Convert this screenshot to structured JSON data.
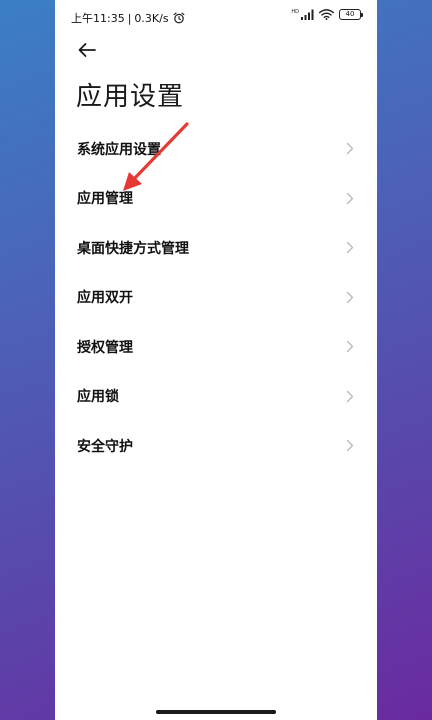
{
  "status_bar": {
    "time": "上午11:35",
    "separator": "|",
    "network_speed": "0.3K/s",
    "signal_label": "HD",
    "battery_level": "40"
  },
  "header": {
    "title": "应用设置"
  },
  "settings": [
    {
      "label": "系统应用设置"
    },
    {
      "label": "应用管理"
    },
    {
      "label": "桌面快捷方式管理"
    },
    {
      "label": "应用双开"
    },
    {
      "label": "授权管理"
    },
    {
      "label": "应用锁"
    },
    {
      "label": "安全守护"
    }
  ],
  "colors": {
    "annotation_arrow": "#e53935",
    "chevron": "#b8b8b8"
  },
  "icons": {
    "back": "back-arrow-icon",
    "alarm": "alarm-icon",
    "signal": "signal-icon",
    "wifi": "wifi-icon",
    "battery": "battery-icon",
    "chevron": "chevron-right-icon"
  }
}
